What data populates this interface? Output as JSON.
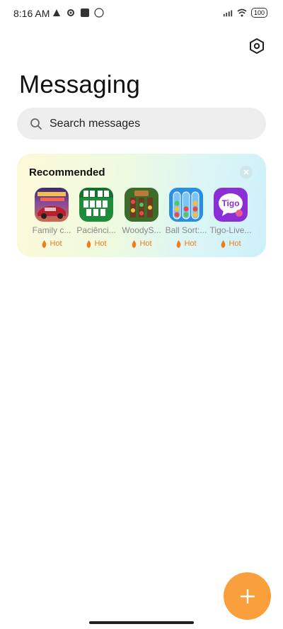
{
  "status_bar": {
    "time": "8:16 AM",
    "battery": "100"
  },
  "page": {
    "title": "Messaging"
  },
  "search": {
    "placeholder": "Search messages"
  },
  "recommended": {
    "title": "Recommended",
    "apps": [
      {
        "label": "Family c...",
        "badge": "Hot"
      },
      {
        "label": "Paciênci...",
        "badge": "Hot"
      },
      {
        "label": "WoodyS...",
        "badge": "Hot"
      },
      {
        "label": "Ball Sort:...",
        "badge": "Hot"
      },
      {
        "label": "Tigo-Live...",
        "badge": "Hot",
        "icon_text": "Tigo"
      }
    ]
  },
  "colors": {
    "fab": "#f9a03c",
    "hot": "#f07c1a",
    "search_bg": "#eeeeee"
  }
}
